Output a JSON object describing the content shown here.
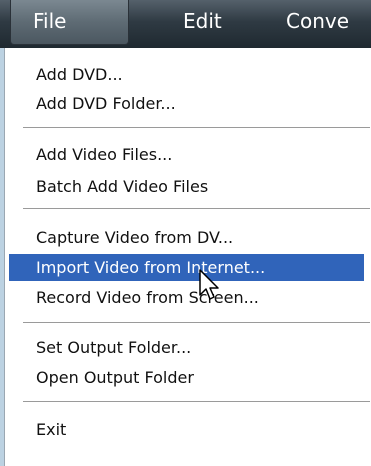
{
  "menubar": {
    "items": [
      {
        "label": "File",
        "active": true
      },
      {
        "label": "Edit",
        "active": false
      },
      {
        "label": "Conve",
        "active": false
      }
    ]
  },
  "menu": {
    "groups": [
      {
        "items": [
          {
            "label": "Add DVD..."
          },
          {
            "label": "Add DVD Folder..."
          }
        ]
      },
      {
        "items": [
          {
            "label": "Add Video Files..."
          },
          {
            "label": "Batch Add Video Files"
          }
        ]
      },
      {
        "items": [
          {
            "label": "Capture Video from DV..."
          },
          {
            "label": "Import Video from Internet...",
            "highlighted": true
          },
          {
            "label": "Record Video from Screen..."
          }
        ]
      },
      {
        "items": [
          {
            "label": "Set Output Folder..."
          },
          {
            "label": "Open Output Folder"
          }
        ]
      },
      {
        "items": [
          {
            "label": "Exit"
          }
        ]
      }
    ]
  },
  "cursor": {
    "icon": "arrow-cursor-icon"
  },
  "colors": {
    "menubar": "#2f3a43",
    "highlight": "#3064ba",
    "menu_background": "#ffffff",
    "page_background": "#bcd2e2"
  }
}
